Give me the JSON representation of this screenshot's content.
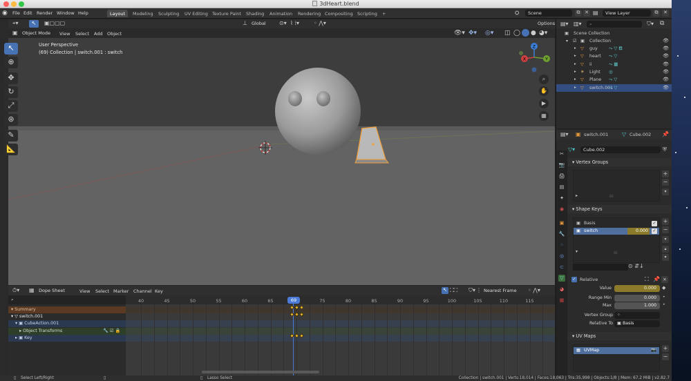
{
  "window": {
    "title": "3dHeart.blend"
  },
  "menu": [
    "File",
    "Edit",
    "Render",
    "Window",
    "Help"
  ],
  "workspaces": [
    "Layout",
    "Modeling",
    "Sculpting",
    "UV Editing",
    "Texture Paint",
    "Shading",
    "Animation",
    "Rendering",
    "Compositing",
    "Scripting",
    "+"
  ],
  "active_workspace": "Layout",
  "scene": {
    "label": "Scene",
    "view_layer": "View Layer"
  },
  "viewport_header": {
    "mode": "Object Mode",
    "menus": [
      "View",
      "Select",
      "Add",
      "Object"
    ],
    "transform_orientation": "Global",
    "options": "Options"
  },
  "viewport": {
    "info_line1": "User Perspective",
    "info_line2": "(69) Collection | switch.001 : switch",
    "gizmo": {
      "x": "X",
      "y": "Y",
      "z": "Z"
    }
  },
  "dopesheet": {
    "mode": "Dope Sheet",
    "menus": [
      "View",
      "Select",
      "Marker",
      "Channel",
      "Key"
    ],
    "snap": "Nearest Frame",
    "current_frame": "69",
    "ticks": [
      "40",
      "45",
      "50",
      "55",
      "60",
      "65",
      "70",
      "75",
      "80",
      "85",
      "90",
      "95",
      "100",
      "105",
      "110",
      "115"
    ],
    "channels": [
      {
        "label": "Summary",
        "color": "#5a3a22",
        "text": "#e0c0a0"
      },
      {
        "label": "switch.001",
        "color": "#2b2b2b",
        "text": "#e8e8e8"
      },
      {
        "label": "CubeAction.001",
        "color": "#2a3850",
        "text": "#c8d4e8"
      },
      {
        "label": "Object Transforms",
        "color": "#2d3f29",
        "text": "#cfe0c8"
      },
      {
        "label": "Key",
        "color": "#2a3850",
        "text": "#c8d4e8"
      }
    ]
  },
  "outliner": {
    "search_placeholder": "",
    "root": "Scene Collection",
    "collection": "Collection",
    "items": [
      {
        "name": "guy",
        "color": "#e59a3a"
      },
      {
        "name": "heart",
        "color": "#e59a3a"
      },
      {
        "name": "ii",
        "color": "#e59a3a"
      },
      {
        "name": "Light",
        "color": "#e8c070"
      },
      {
        "name": "Plane",
        "color": "#e59a3a"
      },
      {
        "name": "switch.001",
        "color": "#e59a3a"
      }
    ],
    "selected": "switch.001"
  },
  "properties": {
    "object": "switch.001",
    "mesh": "Cube.002",
    "datablock": "Cube.002",
    "vertex_groups_title": "Vertex Groups",
    "shape_keys_title": "Shape Keys",
    "shape_keys": [
      {
        "name": "Basis",
        "value": ""
      },
      {
        "name": "switch",
        "value": "0.000"
      }
    ],
    "relative_label": "Relative",
    "value_label": "Value",
    "value": "0.000",
    "range_min_label": "Range Min",
    "range_min": "0.000",
    "max_label": "Max",
    "max": "1.000",
    "vertex_group_label": "Vertex Group",
    "relative_to_label": "Relative To",
    "relative_to": "Basis",
    "uv_maps_title": "UV Maps",
    "uv_map": "UVMap"
  },
  "statusbar": {
    "left1": "Select Left/Right",
    "left2": "Lasso Select",
    "right": "Collection | switch.001 | Verts:18,014 | Faces:18,063 | Tris:35,998 | Objects:1/8 | Mem: 67.2 MiB | v2.82.7"
  },
  "colors": {
    "accent": "#4772b3",
    "keyframe": "#e8b020",
    "playhead": "#4b7bd6",
    "value_field": "#8a7a2a"
  }
}
